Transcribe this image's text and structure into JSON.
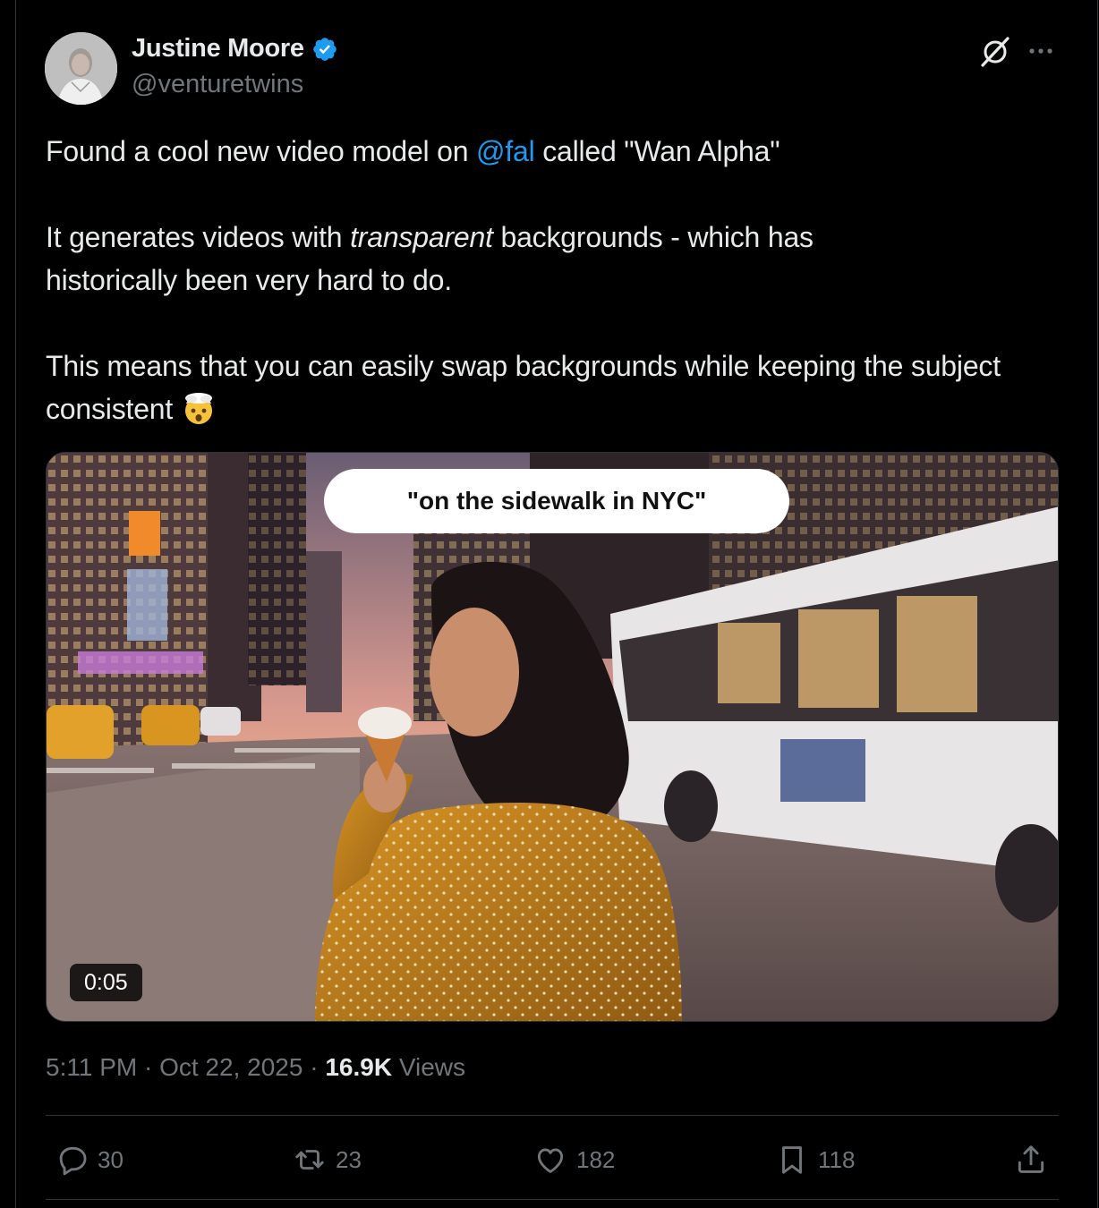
{
  "author": {
    "name": "Justine Moore",
    "handle": "@venturetwins",
    "verified": true
  },
  "tweet": {
    "line1_before": "Found a cool new video model on ",
    "line1_mention": "@fal",
    "line1_after": " called \"Wan Alpha\"",
    "para2_before": "It generates videos with ",
    "para2_italic": "transparent",
    "para2_after": " backgrounds - which has historically been very hard to do.",
    "para3": "This means that you can easily swap backgrounds while keeping the subject consistent",
    "emoji": "exploding-head-emoji"
  },
  "media": {
    "caption": "\"on the sidewalk in NYC\"",
    "duration": "0:05"
  },
  "meta": {
    "time": "5:11 PM",
    "sep1": " · ",
    "date": "Oct 22, 2025",
    "sep2": " · ",
    "views_count": "16.9K",
    "views_label": " Views"
  },
  "actions": {
    "replies": "30",
    "reposts": "23",
    "likes": "182",
    "bookmarks": "118"
  },
  "colors": {
    "background": "#000000",
    "text": "#e7e9ea",
    "secondary": "#71767b",
    "accent": "#1d9bf0",
    "border": "#2f3336"
  },
  "icons": [
    "grok-icon",
    "more-icon",
    "verified-badge-icon",
    "reply-icon",
    "repost-icon",
    "like-icon",
    "bookmark-icon",
    "share-icon"
  ]
}
